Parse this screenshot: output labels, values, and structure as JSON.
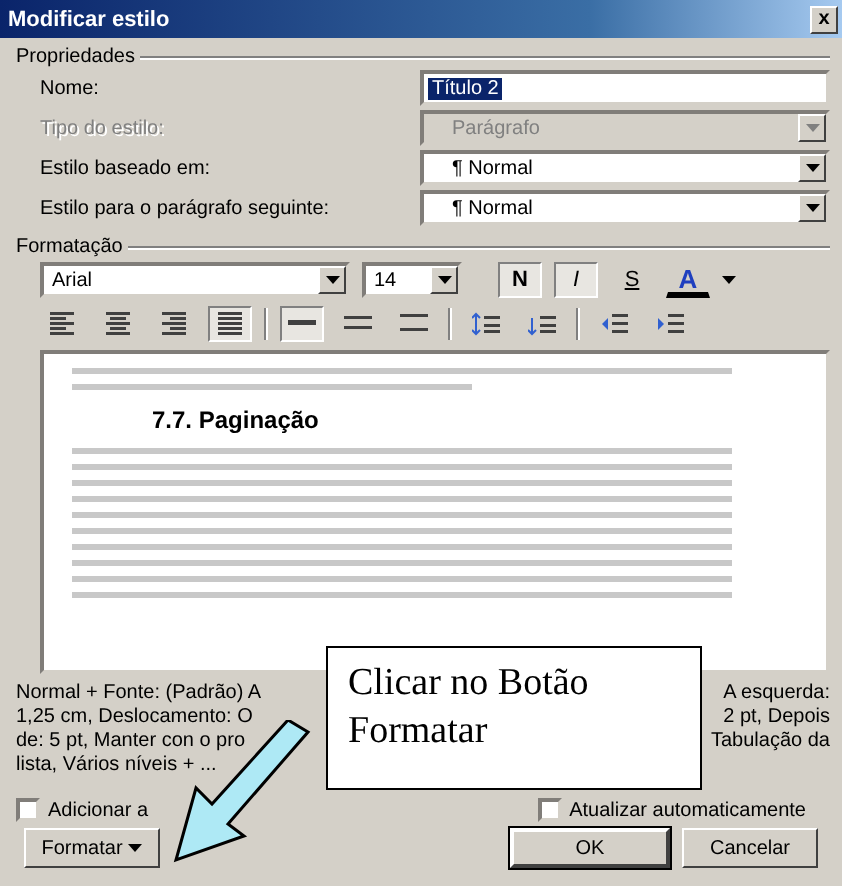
{
  "window": {
    "title": "Modificar estilo",
    "close": "x"
  },
  "properties": {
    "legend": "Propriedades",
    "fields": [
      {
        "label": "Nome:",
        "value": "Título 2",
        "kind": "text",
        "disabled": false,
        "highlighted": true
      },
      {
        "label": "Tipo do estilo:",
        "value": "Parágrafo",
        "kind": "select",
        "disabled": true,
        "highlighted": false
      },
      {
        "label": "Estilo baseado em:",
        "value": "¶ Normal",
        "kind": "select",
        "disabled": false,
        "highlighted": false
      },
      {
        "label": "Estilo para o parágrafo seguinte:",
        "value": "¶ Normal",
        "kind": "select",
        "disabled": false,
        "highlighted": false
      }
    ]
  },
  "formatting": {
    "legend": "Formatação",
    "font": "Arial",
    "size": "14",
    "styles": [
      {
        "label": "N",
        "kind": "bold",
        "pressed": true
      },
      {
        "label": "I",
        "kind": "italic",
        "pressed": true
      },
      {
        "label": "S",
        "kind": "underline",
        "pressed": false
      }
    ],
    "color_label": "A",
    "alignment": [
      {
        "kind": "left",
        "pressed": false
      },
      {
        "kind": "center",
        "pressed": false
      },
      {
        "kind": "right",
        "pressed": false
      },
      {
        "kind": "justify",
        "pressed": true
      }
    ],
    "spacing": [
      {
        "kind": "single",
        "pressed": true
      },
      {
        "kind": "one-half",
        "pressed": false
      },
      {
        "kind": "double",
        "pressed": false
      }
    ]
  },
  "preview": {
    "heading": "7.7. Paginação"
  },
  "description": [
    {
      "left": "Normal + Fonte: (Padrão) A",
      "right": "A esquerda:"
    },
    {
      "left": "1,25 cm, Deslocamento: O",
      "right": "2 pt, Depois"
    },
    {
      "left": "de: 5 pt, Manter con o pro",
      "right": "Tabulação da"
    },
    {
      "left": "lista, Vários níveis + ..."
    }
  ],
  "callout": {
    "text": "Clicar no Botão Formatar"
  },
  "options": [
    {
      "label": "Adicionar a",
      "checked": false
    },
    {
      "label": "Atualizar automaticamente",
      "checked": false
    }
  ],
  "buttons": [
    {
      "label": "Formatar",
      "kind": "menu"
    },
    {
      "label": "OK",
      "kind": "default"
    },
    {
      "label": "Cancelar",
      "kind": "plain"
    }
  ]
}
